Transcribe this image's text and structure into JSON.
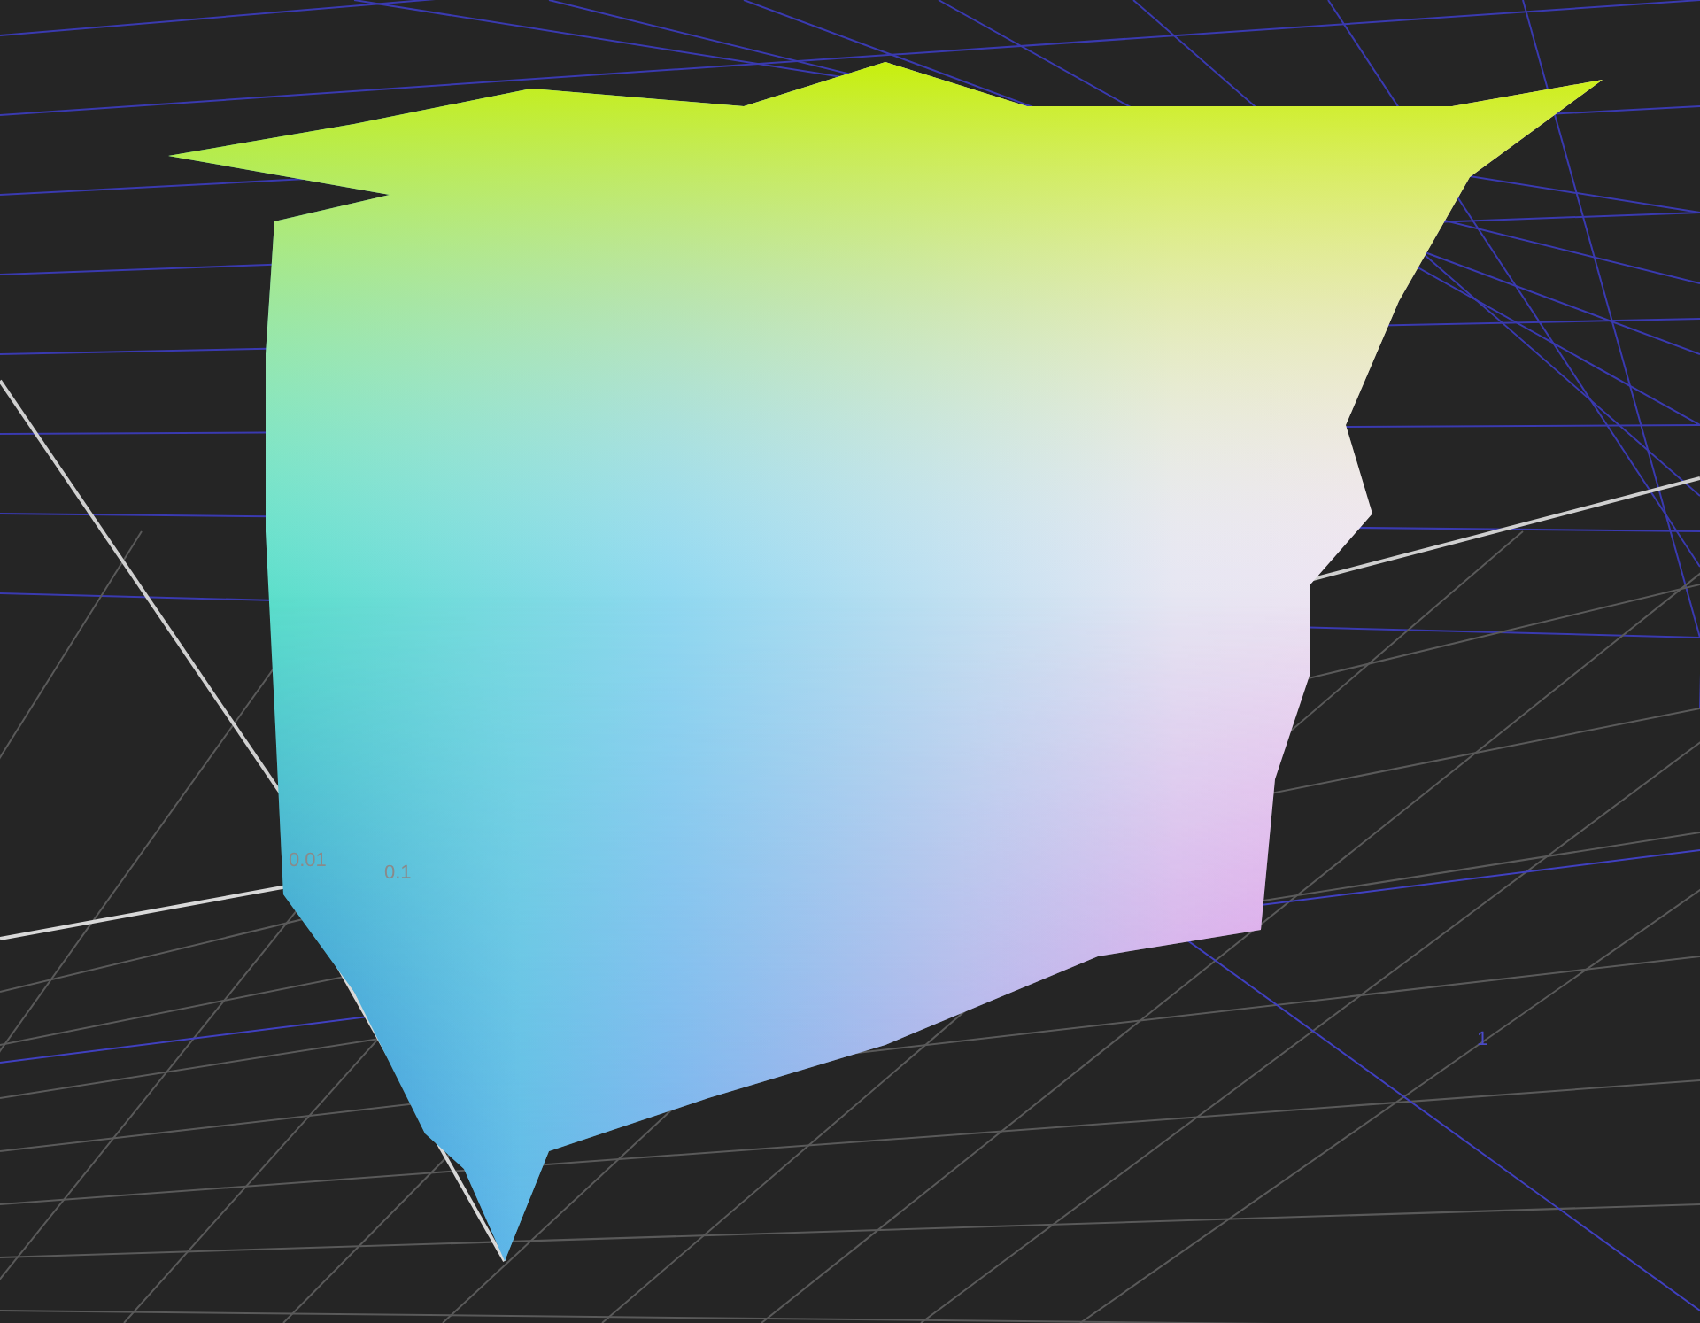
{
  "viewport": {
    "axis_labels": [
      {
        "text": "0.01"
      },
      {
        "text": "0.1"
      },
      {
        "text": "1"
      }
    ]
  }
}
